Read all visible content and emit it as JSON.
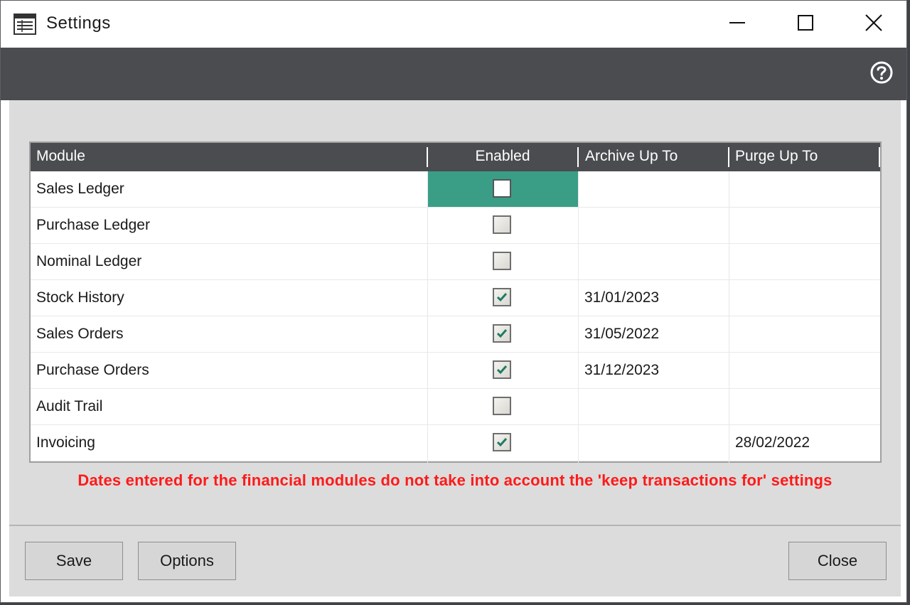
{
  "window": {
    "title": "Settings",
    "minimize_icon": "minimize-icon",
    "maximize_icon": "maximize-icon",
    "close_icon": "close-icon",
    "help_icon": "help-icon"
  },
  "grid": {
    "columns": [
      "Module",
      "Enabled",
      "Archive Up To",
      "Purge Up To"
    ],
    "rows": [
      {
        "module": "Sales Ledger",
        "enabled": false,
        "archive": "",
        "purge": "",
        "selected": true
      },
      {
        "module": "Purchase Ledger",
        "enabled": false,
        "archive": "",
        "purge": ""
      },
      {
        "module": "Nominal Ledger",
        "enabled": false,
        "archive": "",
        "purge": ""
      },
      {
        "module": "Stock History",
        "enabled": true,
        "archive": "31/01/2023",
        "purge": ""
      },
      {
        "module": "Sales Orders",
        "enabled": true,
        "archive": "31/05/2022",
        "purge": ""
      },
      {
        "module": "Purchase Orders",
        "enabled": true,
        "archive": "31/12/2023",
        "purge": ""
      },
      {
        "module": "Audit Trail",
        "enabled": false,
        "archive": "",
        "purge": ""
      },
      {
        "module": "Invoicing",
        "enabled": true,
        "archive": "",
        "purge": "28/02/2022"
      }
    ]
  },
  "warning": "Dates entered for the financial modules do not take into account the 'keep transactions for' settings",
  "footer": {
    "save_label": "Save",
    "options_label": "Options",
    "close_label": "Close"
  },
  "colors": {
    "header_bg": "#4a4c50",
    "selected_cell": "#3a9e87",
    "check_color": "#1f7a65",
    "warning_text": "#ff1a1a"
  }
}
